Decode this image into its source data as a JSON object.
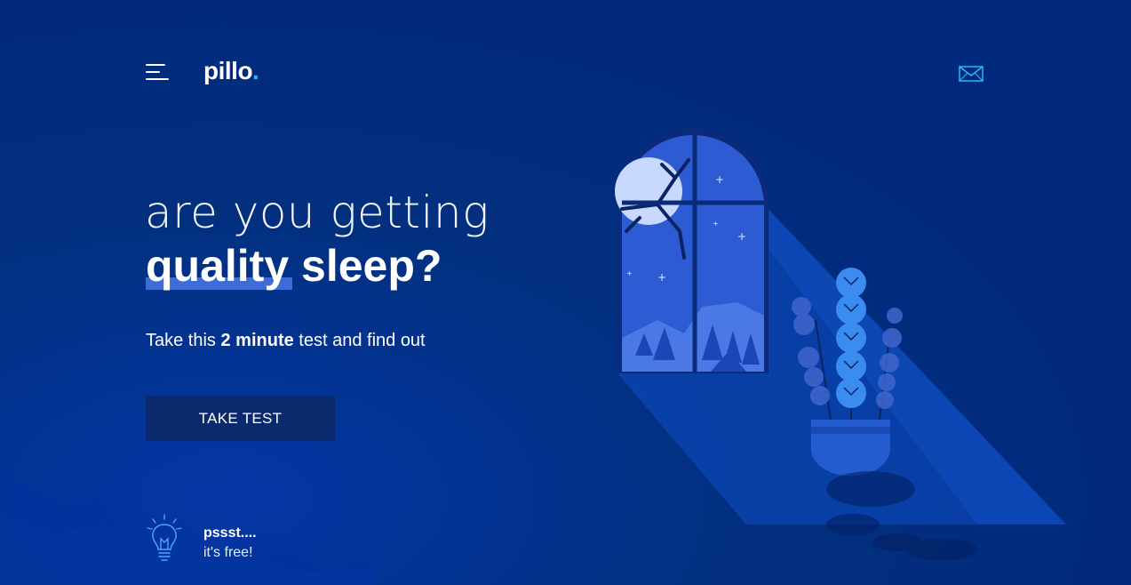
{
  "header": {
    "logo_text": "pillo",
    "logo_dot": "."
  },
  "hero": {
    "line1": "are you getting",
    "line2_highlight": "quality",
    "line2_rest": " sleep?"
  },
  "subtitle": {
    "prefix": "Take this ",
    "bold": "2 minute",
    "suffix": " test and find out"
  },
  "cta": {
    "label": "TAKE TEST"
  },
  "note": {
    "title": "pssst....",
    "subtitle": "it's free!"
  },
  "icons": {
    "menu": "hamburger-menu-icon",
    "mail": "envelope-icon",
    "bulb": "lightbulb-icon"
  },
  "colors": {
    "background": "#012a7c",
    "accent": "#29b6f6",
    "highlight": "#3d6cd6",
    "button": "#0a2a6d"
  }
}
